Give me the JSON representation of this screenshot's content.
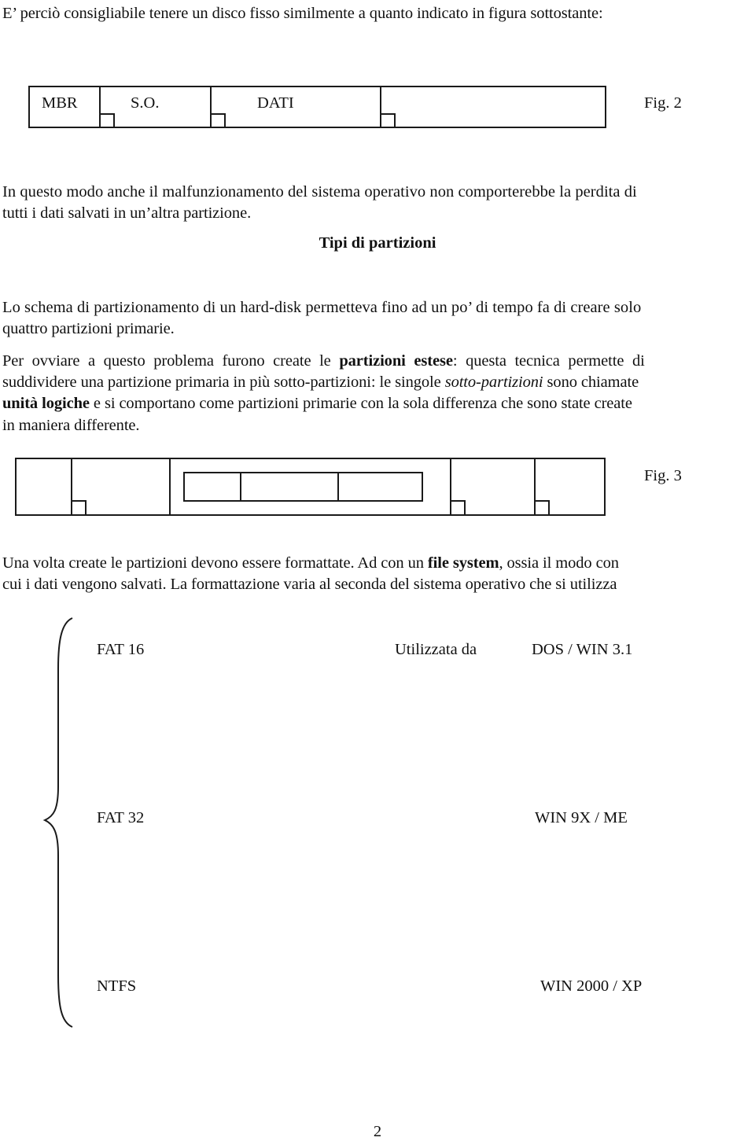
{
  "intro": "E’ perciò consigliabile tenere un disco fisso similmente a quanto indicato in figura sottostante:",
  "fig2": {
    "segments": [
      "MBR",
      "S.O.",
      "DATI",
      ""
    ],
    "caption": "Fig. 2"
  },
  "para1": {
    "line1": "In questo modo anche il malfunzionamento del sistema operativo non comporterebbe la perdita di",
    "line2": "tutti i dati salvati in un’altra partizione."
  },
  "heading": "Tipi di partizioni",
  "para2": {
    "line1": "Lo schema di partizionamento di un hard-disk permetteva fino  ad un po’ di tempo fa di creare solo",
    "line2": "quattro partizioni primarie."
  },
  "para3": {
    "l1_a": "Per ovviare a questo problema furono create le",
    "l1_bold": "partizioni estese",
    "l1_b": ": questa tecnica permette di",
    "l2_a": "suddividere una partizione primaria in più sotto-partizioni: le singole",
    "l2_italic": "sotto-partizioni",
    "l2_b": " sono chiamate",
    "l3_bold": "unità logiche",
    "l3_b": " e si comportano come partizioni primarie con la sola differenza che sono state create",
    "l4": "in maniera differente."
  },
  "fig3": {
    "caption": "Fig. 3"
  },
  "para4": {
    "l1_a": "Una volta create le partizioni devono essere formattate. Ad con un ",
    "l1_bold": "file system",
    "l1_b": ", ossia il modo con",
    "l2": "cui i dati vengono salvati. La formattazione varia al seconda del sistema operativo che si utilizza"
  },
  "filesystems": [
    {
      "name": "FAT 16",
      "used_by_label": "Utilizzata da",
      "os": "DOS / WIN 3.1"
    },
    {
      "name": "FAT 32",
      "used_by_label": "",
      "os": "WIN 9X / ME"
    },
    {
      "name": "NTFS",
      "used_by_label": "",
      "os": "WIN 2000 / XP"
    }
  ],
  "page_number": "2"
}
